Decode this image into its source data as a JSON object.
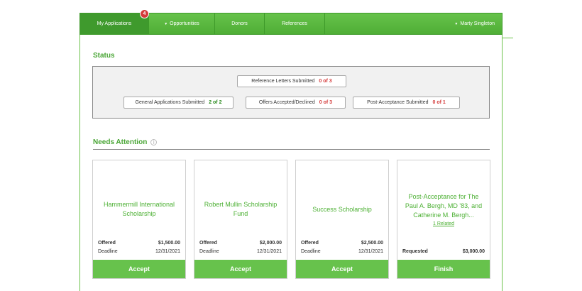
{
  "nav": {
    "tabs": [
      {
        "label": "My Applications",
        "badge": "4"
      },
      {
        "label": "Opportunities"
      },
      {
        "label": "Donors"
      },
      {
        "label": "References"
      }
    ],
    "user": "Marty Singleton"
  },
  "status": {
    "title": "Status",
    "items": [
      {
        "label": "Reference Letters Submitted",
        "value": "0 of 3",
        "color": "#d43a3a"
      },
      {
        "label": "General Applications Submitted",
        "value": "2 of 2",
        "color": "#2a8a1e"
      },
      {
        "label": "Offers Accepted/Declined",
        "value": "0 of 3",
        "color": "#d43a3a"
      },
      {
        "label": "Post-Acceptance Submitted",
        "value": "0 of 1",
        "color": "#d43a3a"
      }
    ]
  },
  "attention": {
    "title": "Needs Attention",
    "cards": [
      {
        "title": "Hammermill International Scholarship",
        "row1_label": "Offered",
        "row1_value": "$1,500.00",
        "row2_label": "Deadline",
        "row2_value": "12/31/2021",
        "button": "Accept"
      },
      {
        "title": "Robert Mullin Scholarship Fund",
        "row1_label": "Offered",
        "row1_value": "$2,000.00",
        "row2_label": "Deadline",
        "row2_value": "12/31/2021",
        "button": "Accept"
      },
      {
        "title": "Success Scholarship",
        "row1_label": "Offered",
        "row1_value": "$2,500.00",
        "row2_label": "Deadline",
        "row2_value": "12/31/2021",
        "button": "Accept"
      },
      {
        "title": "Post-Acceptance for The Paul A. Bergh, MD '83, and Catherine M. Bergh...",
        "link": "1 Related",
        "row2_label": "Requested",
        "row2_value": "$3,000.00",
        "button": "Finish"
      }
    ]
  },
  "colors": {
    "brand_green": "#4fae36",
    "alert_red": "#d43a3a"
  }
}
